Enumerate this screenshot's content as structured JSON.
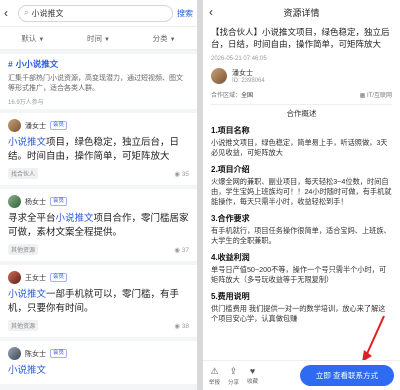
{
  "left": {
    "back_icon": "back-arrow-icon",
    "search_value": "小说推文",
    "search_btn": "搜索",
    "filters": [
      "默认",
      "时间",
      "分类"
    ],
    "circle": {
      "title": "小小说推文",
      "desc": "汇集千部热门小说资源，高变现潜力，通过短视频、图文等形式推广，适合各类人群。",
      "count": "16.9万人参与"
    },
    "posts": [
      {
        "name": "潘女士",
        "badge": "会员",
        "text_kw": "小说推文",
        "text": "项目，绿色稳定，独立后台，日结。时间自由，操作简单，可矩阵放大",
        "tag": "找合伙人",
        "views": "35"
      },
      {
        "name": "杨女士",
        "badge": "会员",
        "text_pre": "寻求全平台",
        "text_kw": "小说推文",
        "text": "项目合作，零门槛居家可做，素材文案全程提供。",
        "tag": "其他资源",
        "views": "37"
      },
      {
        "name": "王女士",
        "badge": "会员",
        "text_kw": "小说推文",
        "text": "一部手机就可以，零门槛，有手机，只要你有时间。",
        "tag": "其他资源",
        "views": "38"
      },
      {
        "name": "陈女士",
        "badge": "会员",
        "text_kw": "小说推文",
        "text": "",
        "tag": "",
        "views": ""
      }
    ]
  },
  "right": {
    "title": "资源详情",
    "headline": "【找合伙人】小说推文项目，绿色稳定，独立后台，日结，时间自由，操作简单，可矩阵放大",
    "meta": "2026-05-21 07:46:05",
    "owner_name": "潘女士",
    "owner_id": "ID: 2398064",
    "region_label": "合作区域：",
    "region_value": "全国",
    "industry": "IT/互联网",
    "section": "合作概述",
    "sections": [
      {
        "h": "1.项目名称",
        "p": "小说推文项目，绿色稳定，简单易上手，听话照做，3天必见收益，可矩阵放大"
      },
      {
        "h": "2.项目介绍",
        "p": "火爆全网的兼职、副业项目，每天轻松3~4位数，时间自由，学生宝妈上班族均可！！24小时随时可做，有手机就能操作，每天只需半小时，收益轻松到手！"
      },
      {
        "h": "3.合作要求",
        "p": "有手机就行，项目任务操作很简单，适合宝妈、上班族、大学生的全职兼职。"
      },
      {
        "h": "4.收益利润",
        "p": "单号日产值50~200不等，操作一个号只需半个小时，可矩阵放大（多号玩收益等于无限复制）"
      },
      {
        "h": "5.费用说明",
        "p": "供门槛费用 我们提供一对一的数学培训，放心来了解这个项目安心学，认真做包赚"
      }
    ],
    "bottom": [
      "举报",
      "分享",
      "收藏"
    ],
    "cta": "立即 查看联系方式"
  }
}
